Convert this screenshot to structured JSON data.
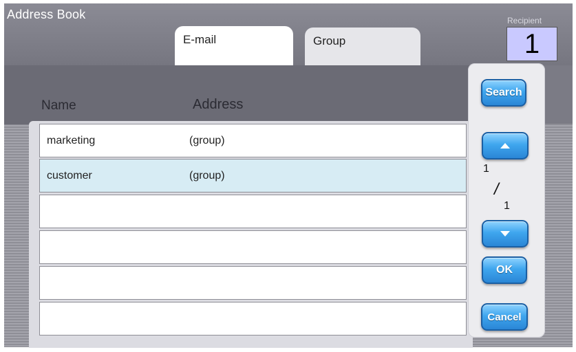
{
  "window": {
    "title": "Address Book"
  },
  "tabs": [
    {
      "label": "E-mail",
      "active": true
    },
    {
      "label": "Group",
      "active": false
    }
  ],
  "recipient": {
    "label": "Recipient",
    "count": "1"
  },
  "columns": {
    "name": "Name",
    "address": "Address"
  },
  "rows": [
    {
      "name": "marketing",
      "address": "(group)",
      "selected": false
    },
    {
      "name": "customer",
      "address": "(group)",
      "selected": true
    },
    {
      "name": "",
      "address": "",
      "selected": false
    },
    {
      "name": "",
      "address": "",
      "selected": false
    },
    {
      "name": "",
      "address": "",
      "selected": false
    },
    {
      "name": "",
      "address": "",
      "selected": false
    }
  ],
  "pagination": {
    "current": "1",
    "separator": "/",
    "total": "1"
  },
  "buttons": {
    "search": "Search",
    "ok": "OK",
    "cancel": "Cancel"
  },
  "icons": {
    "up": "chevron-up-icon",
    "down": "chevron-down-icon"
  },
  "colors": {
    "selected_row": "#d7ecf4",
    "button": "#3fa6ee",
    "recipient_box": "#c9c9ff"
  }
}
